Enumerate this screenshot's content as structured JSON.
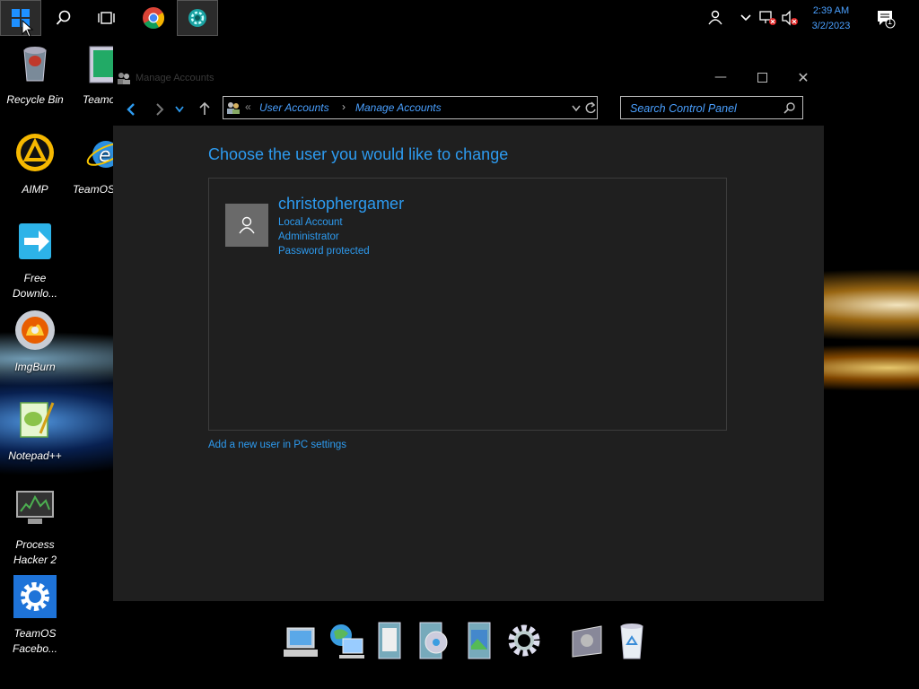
{
  "taskbar": {
    "clock_time": "2:39 AM",
    "clock_date": "3/2/2023",
    "notification_count": "1"
  },
  "desktop_icons": [
    {
      "label": "Recycle Bin"
    },
    {
      "label": "Teamo"
    },
    {
      "label": "AIMP"
    },
    {
      "label": "TeamOS"
    },
    {
      "label": "Free Downlo..."
    },
    {
      "label": "ImgBurn"
    },
    {
      "label": "Notepad++"
    },
    {
      "label": "Process Hacker 2"
    },
    {
      "label": "TeamOS Facebo..."
    }
  ],
  "window": {
    "title": "Manage Accounts",
    "breadcrumb": [
      "User Accounts",
      "Manage Accounts"
    ],
    "breadcrumb_prefix": "«",
    "search_placeholder": "Search Control Panel",
    "heading": "Choose the user you would like to change",
    "user": {
      "name": "christophergamer",
      "details": [
        "Local Account",
        "Administrator",
        "Password protected"
      ]
    },
    "add_user_link": "Add a new user in PC settings"
  }
}
